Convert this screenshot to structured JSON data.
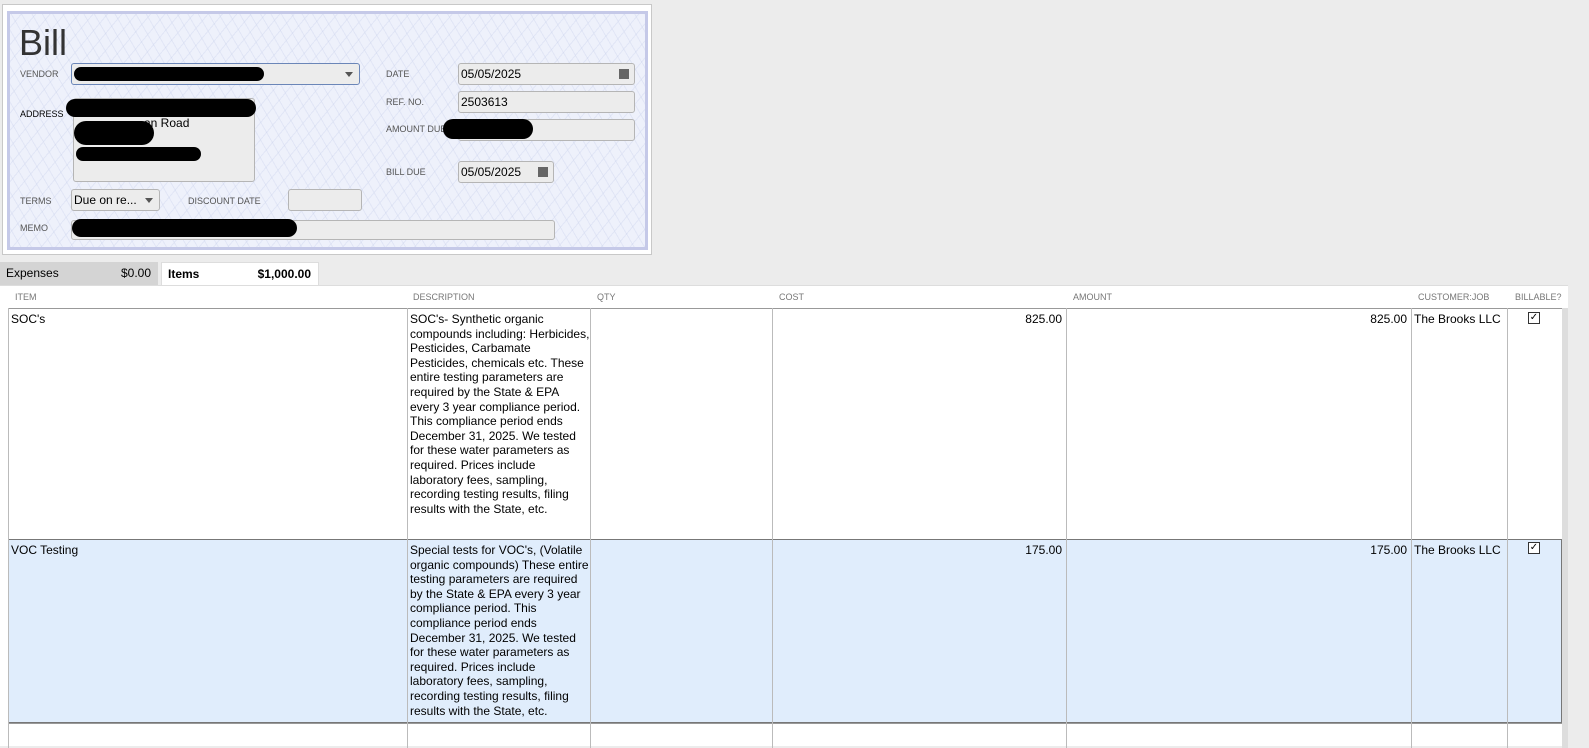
{
  "form": {
    "title": "Bill",
    "vendor_label": "VENDOR",
    "address_label": "ADDRESS",
    "address_fragment": "an Road",
    "date_label": "DATE",
    "date": "05/05/2025",
    "ref_label": "REF. NO.",
    "ref": "2503613",
    "amount_due_label": "AMOUNT DUE",
    "bill_due_label": "BILL DUE",
    "bill_due": "05/05/2025",
    "terms_label": "TERMS",
    "terms": "Due on re...",
    "discount_label": "DISCOUNT DATE",
    "memo_label": "MEMO"
  },
  "tabs": [
    {
      "label": "Expenses",
      "amount": "$0.00"
    },
    {
      "label": "Items",
      "amount": "$1,000.00"
    }
  ],
  "columns": [
    "ITEM",
    "DESCRIPTION",
    "QTY",
    "COST",
    "AMOUNT",
    "CUSTOMER:JOB",
    "BILLABLE?"
  ],
  "rows": [
    {
      "item": "SOC's",
      "description": "SOC's- Synthetic organic compounds including: Herbicides, Pesticides, Carbamate Pesticides, chemicals etc. These entire testing parameters are required by the State & EPA every 3 year compliance period. This compliance period ends December 31, 2025. We tested for these water parameters as required. Prices include laboratory fees, sampling, recording testing results, filing results with the State, etc.",
      "qty": "",
      "cost": "825.00",
      "amount": "825.00",
      "customer": "The Brooks LLC",
      "billable": true
    },
    {
      "item": "VOC Testing",
      "description": "Special tests for VOC's, (Volatile organic compounds) These entire testing parameters are required by the State & EPA every 3 year compliance period. This compliance period ends December 31, 2025. We tested for these water parameters as required. Prices include laboratory fees, sampling, recording testing results, filing results with the State, etc.",
      "qty": "",
      "cost": "175.00",
      "amount": "175.00",
      "customer": "The Brooks LLC",
      "billable": true
    }
  ]
}
